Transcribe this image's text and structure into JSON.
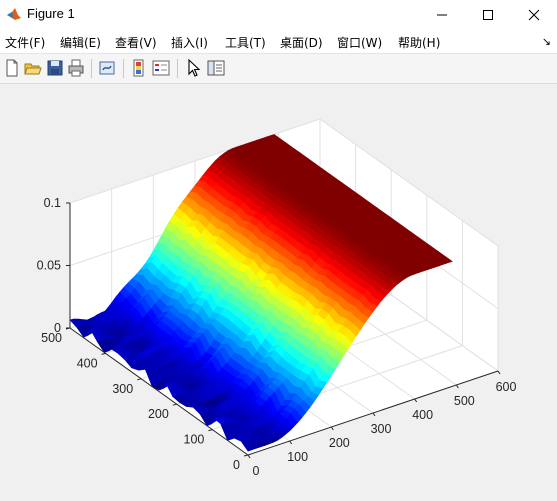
{
  "window": {
    "title": "Figure 1"
  },
  "menu": [
    "文件(F)",
    "编辑(E)",
    "查看(V)",
    "插入(I)",
    "工具(T)",
    "桌面(D)",
    "窗口(W)",
    "帮助(H)"
  ],
  "toolbar": {
    "icons": [
      "new-figure-icon",
      "open-file-icon",
      "save-icon",
      "print-icon",
      "link-plot-icon",
      "insert-colorbar-icon",
      "insert-legend-icon",
      "edit-plot-icon",
      "property-inspector-icon"
    ]
  },
  "chart_data": {
    "type": "surface",
    "colormap": "jet",
    "x": {
      "lim": [
        0,
        600
      ],
      "ticks": [
        "0",
        "100",
        "200",
        "300",
        "400",
        "500",
        "600"
      ]
    },
    "y": {
      "lim": [
        0,
        500
      ],
      "ticks": [
        "0",
        "100",
        "200",
        "300",
        "400",
        "500"
      ]
    },
    "z": {
      "lim": [
        0,
        0.1
      ],
      "ticks": [
        "0",
        "0.05",
        "0.1"
      ]
    },
    "grid": true,
    "surface": {
      "plateau_x_start": 400,
      "plateau_z": 0.1,
      "ramp_x": [
        0,
        400
      ],
      "rise_x_start": 50
    }
  }
}
